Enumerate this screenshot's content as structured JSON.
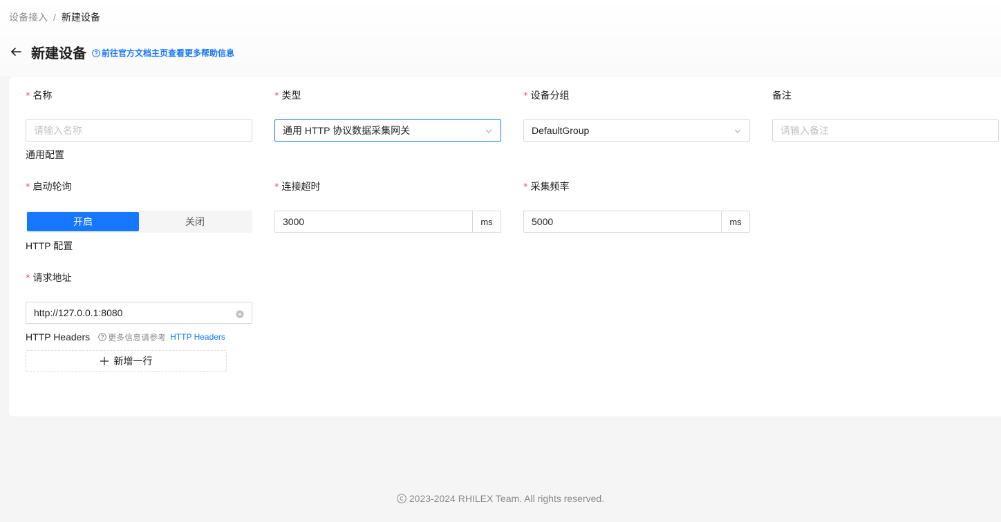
{
  "breadcrumb": {
    "parent": "设备接入",
    "separator": "/",
    "current": "新建设备"
  },
  "header": {
    "title": "新建设备",
    "help_link": "前往官方文档主页查看更多帮助信息"
  },
  "form": {
    "name": {
      "label": "名称",
      "required": "*",
      "placeholder": "请输入名称"
    },
    "type": {
      "label": "类型",
      "required": "*",
      "value": "通用 HTTP 协议数据采集网关"
    },
    "group": {
      "label": "设备分组",
      "required": "*",
      "value": "DefaultGroup"
    },
    "remark": {
      "label": "备注",
      "placeholder": "请输入备注"
    },
    "common_section": "通用配置",
    "autoPoll": {
      "label": "启动轮询",
      "required": "*",
      "on": "开启",
      "off": "关闭",
      "selected": "开启"
    },
    "timeout": {
      "label": "连接超时",
      "required": "*",
      "value": "3000",
      "unit": "ms"
    },
    "frequency": {
      "label": "采集频率",
      "required": "*",
      "value": "5000",
      "unit": "ms"
    },
    "http_section": "HTTP 配置",
    "url": {
      "label": "请求地址",
      "required": "*",
      "value": "http://127.0.0.1:8080"
    },
    "headers": {
      "label": "HTTP Headers",
      "hint": "更多信息请参考",
      "link": "HTTP Headers",
      "add_button": "新增一行"
    }
  },
  "footer": {
    "text": "2023-2024 RHILEX Team. All rights reserved."
  },
  "colors": {
    "primary": "#1677ff",
    "required": "#ff4d4f",
    "background": "#f5f5f5"
  }
}
